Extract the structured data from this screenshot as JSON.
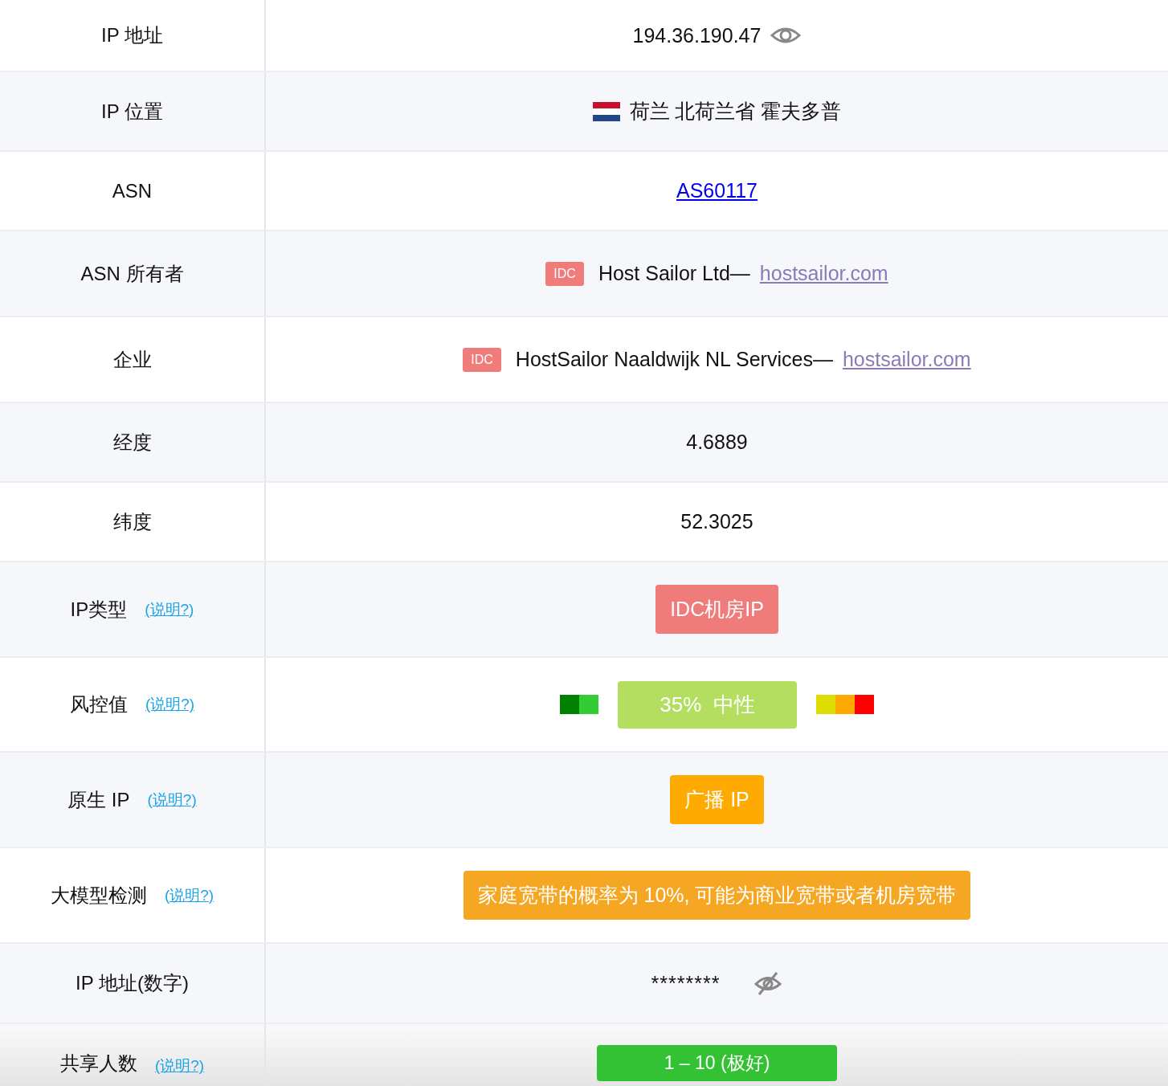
{
  "rows": [
    {
      "label": "IP 地址",
      "kind": "reveal",
      "value": "194.36.190.47"
    },
    {
      "label": "IP 位置",
      "kind": "location",
      "value": "荷兰 北荷兰省 霍夫多普"
    },
    {
      "label": "ASN",
      "kind": "link",
      "value": "AS60117"
    },
    {
      "label": "ASN 所有者",
      "kind": "org",
      "tag": "IDC",
      "value": "Host Sailor Ltd—",
      "link": "hostsailor.com"
    },
    {
      "label": "企业",
      "kind": "org",
      "tag": "IDC",
      "value": "HostSailor Naaldwijk NL Services—",
      "link": "hostsailor.com"
    },
    {
      "label": "经度",
      "kind": "text",
      "value": "4.6889"
    },
    {
      "label": "纬度",
      "kind": "text",
      "value": "52.3025"
    },
    {
      "label": "IP类型",
      "note": "(说明?)",
      "kind": "badge",
      "value": "IDC机房IP",
      "color": "#ef7b7b"
    },
    {
      "label": "风控值",
      "note": "(说明?)",
      "kind": "risk",
      "value": "35%  中性",
      "color": "#b3de60",
      "left_segments": [
        {
          "color": "#008000"
        },
        {
          "color": "#33cc33"
        }
      ],
      "right_segments": [
        {
          "color": "#dddd00"
        },
        {
          "color": "#ffaa00"
        },
        {
          "color": "#ff0000"
        }
      ]
    },
    {
      "label": "原生 IP",
      "note": "(说明?)",
      "kind": "badge",
      "value": "广播 IP",
      "color": "#ffaa00"
    },
    {
      "label": "大模型检测",
      "note": "(说明?)",
      "kind": "badge",
      "value": "家庭宽带的概率为 10%, 可能为商业宽带或者机房宽带",
      "color": "#f5a623"
    },
    {
      "label": "IP 地址(数字)",
      "kind": "hidden",
      "value": "********"
    },
    {
      "label": "共享人数",
      "note": "(说明?)",
      "kind": "badge",
      "value": "1 – 10 (极好)",
      "color": "#33c233"
    }
  ]
}
